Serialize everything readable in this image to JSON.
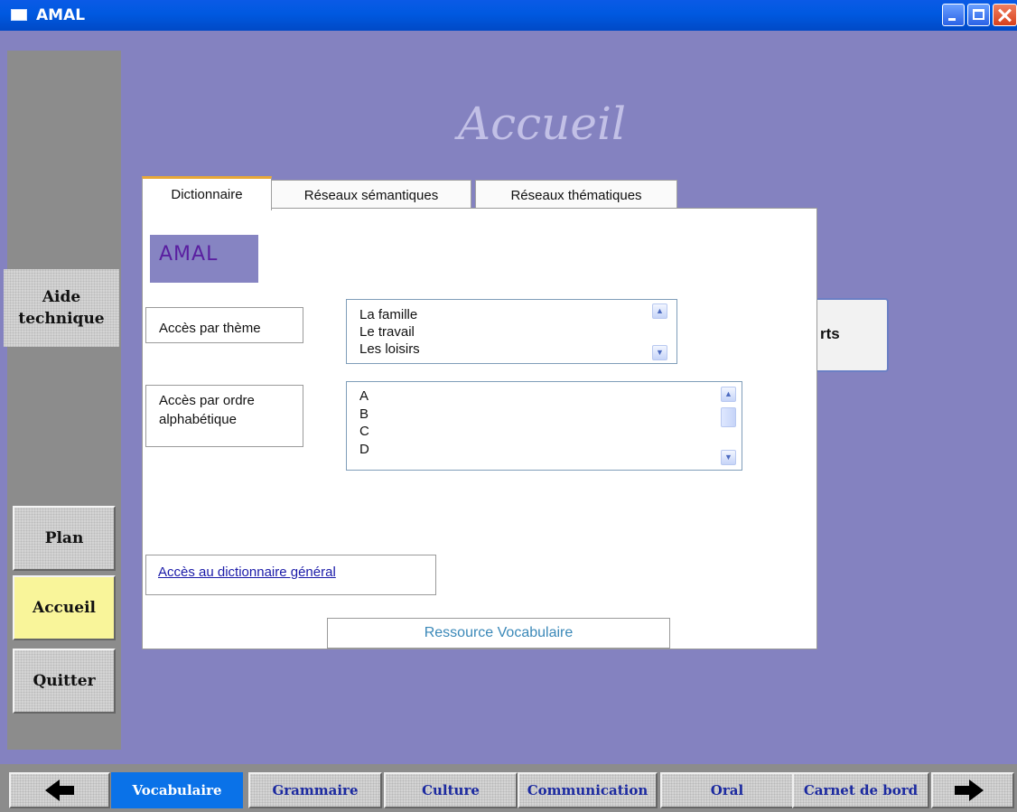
{
  "window": {
    "title": "AMAL"
  },
  "page": {
    "title": "Accueil"
  },
  "sidebar": {
    "aide_line1": "Aide",
    "aide_line2": "technique",
    "plan": "Plan",
    "accueil": "Accueil",
    "quitter": "Quitter"
  },
  "tabs": [
    "Dictionnaire",
    "Réseaux sémantiques",
    "Réseaux thématiques"
  ],
  "panel": {
    "logo": "AMAL",
    "theme_label": "Accès par thème",
    "theme_items": [
      "La famille",
      "Le travail",
      "Les loisirs"
    ],
    "alpha_label_line1": "Accès par ordre",
    "alpha_label_line2": "alphabétique",
    "alpha_items": [
      "A",
      "B",
      "C",
      "D"
    ],
    "dict_link": "Accès au dictionnaire général",
    "ressource": "Ressource Vocabulaire"
  },
  "behind_button_partial": "rts",
  "nav": {
    "items": [
      "Vocabulaire",
      "Grammaire",
      "Culture",
      "Communication",
      "Oral",
      "Carnet de bord"
    ],
    "active": "Vocabulaire"
  },
  "icons": {
    "prev": "arrow-left-icon",
    "next": "arrow-right-icon",
    "window": "window-icon"
  },
  "colors": {
    "background": "#8482c0",
    "titlebar": "#0058e0",
    "active_tab": "#0a72e8",
    "accueil_button": "#f9f59a",
    "nav_text": "#1c2aa0",
    "link": "#1a1aa8"
  }
}
